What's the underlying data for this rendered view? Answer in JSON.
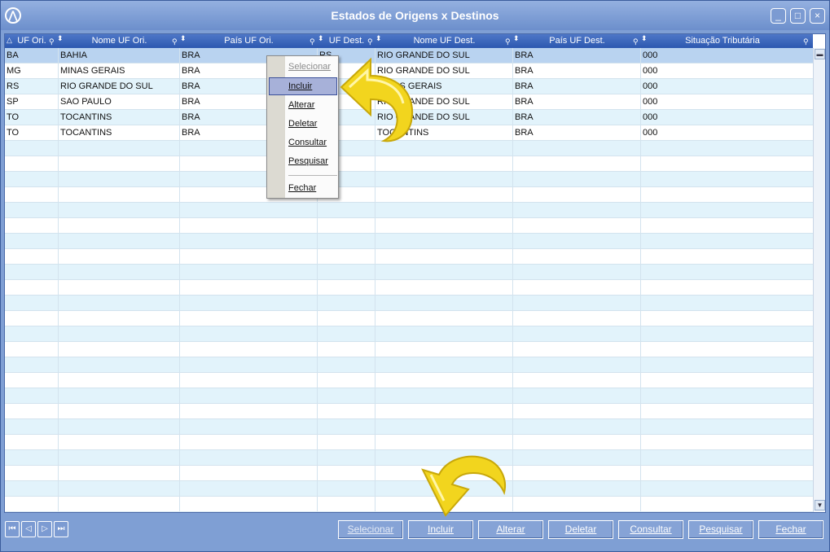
{
  "window": {
    "title": "Estados de Origens x Destinos",
    "buttons": {
      "minimize": "_",
      "maximize": "□",
      "close": "×"
    }
  },
  "grid": {
    "columns": [
      "UF Ori.",
      "Nome UF Ori.",
      "País UF Ori.",
      "UF Dest.",
      "Nome UF Dest.",
      "País UF Dest.",
      "Situação Tributária"
    ],
    "rows": [
      [
        "BA",
        "BAHIA",
        "BRA",
        "RS",
        "RIO GRANDE DO SUL",
        "BRA",
        "000"
      ],
      [
        "MG",
        "MINAS GERAIS",
        "BRA",
        "",
        "RIO GRANDE DO SUL",
        "BRA",
        "000"
      ],
      [
        "RS",
        "RIO GRANDE DO SUL",
        "BRA",
        "",
        "MINAS GERAIS",
        "BRA",
        "000"
      ],
      [
        "SP",
        "SAO PAULO",
        "BRA",
        "",
        "RIO GRANDE DO SUL",
        "BRA",
        "000"
      ],
      [
        "TO",
        "TOCANTINS",
        "BRA",
        "",
        "RIO GRANDE DO SUL",
        "BRA",
        "000"
      ],
      [
        "TO",
        "TOCANTINS",
        "BRA",
        "",
        "TOCANTINS",
        "BRA",
        "000"
      ]
    ],
    "selected_row": 0
  },
  "context_menu": {
    "items": [
      "Selecionar",
      "Incluir",
      "Alterar",
      "Deletar",
      "Consultar",
      "Pesquisar",
      "Fechar"
    ],
    "disabled": [
      "Selecionar"
    ],
    "highlighted": "Incluir"
  },
  "navigation": [
    "first",
    "previous",
    "next",
    "last"
  ],
  "footer_buttons": [
    "Selecionar",
    "Incluir",
    "Alterar",
    "Deletar",
    "Consultar",
    "Pesquisar",
    "Fechar"
  ],
  "colors": {
    "accent": "#2c58b0",
    "row_alt": "#e2f3fb",
    "selected_row": "#b9d3f0",
    "arrow": "#f2d51e"
  }
}
